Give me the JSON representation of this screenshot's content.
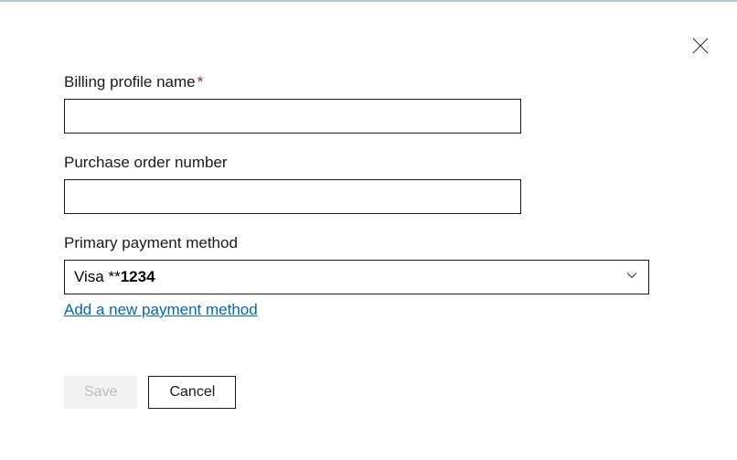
{
  "form": {
    "billing_profile_label": "Billing profile name",
    "billing_profile_value": "",
    "purchase_order_label": "Purchase order number",
    "purchase_order_value": "",
    "payment_method_label": "Primary payment method",
    "payment_method_value_prefix": "Visa **",
    "payment_method_value_last4": "1234",
    "add_payment_link": "Add a new payment method"
  },
  "buttons": {
    "save": "Save",
    "cancel": "Cancel"
  }
}
